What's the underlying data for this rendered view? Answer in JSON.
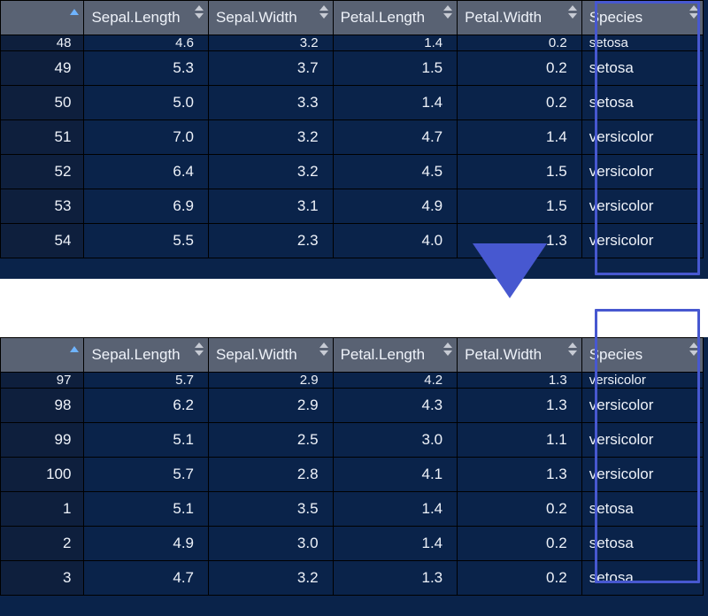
{
  "headers": {
    "index": "",
    "sepal_length": "Sepal.Length",
    "sepal_width": "Sepal.Width",
    "petal_length": "Petal.Length",
    "petal_width": "Petal.Width",
    "species": "Species"
  },
  "top": {
    "partial": {
      "idx": "48",
      "sl": "4.6",
      "sw": "3.2",
      "pl": "1.4",
      "pw": "0.2",
      "sp": "setosa"
    },
    "rows": [
      {
        "idx": "49",
        "sl": "5.3",
        "sw": "3.7",
        "pl": "1.5",
        "pw": "0.2",
        "sp": "setosa"
      },
      {
        "idx": "50",
        "sl": "5.0",
        "sw": "3.3",
        "pl": "1.4",
        "pw": "0.2",
        "sp": "setosa"
      },
      {
        "idx": "51",
        "sl": "7.0",
        "sw": "3.2",
        "pl": "4.7",
        "pw": "1.4",
        "sp": "versicolor"
      },
      {
        "idx": "52",
        "sl": "6.4",
        "sw": "3.2",
        "pl": "4.5",
        "pw": "1.5",
        "sp": "versicolor"
      },
      {
        "idx": "53",
        "sl": "6.9",
        "sw": "3.1",
        "pl": "4.9",
        "pw": "1.5",
        "sp": "versicolor"
      },
      {
        "idx": "54",
        "sl": "5.5",
        "sw": "2.3",
        "pl": "4.0",
        "pw": "1.3",
        "sp": "versicolor"
      }
    ]
  },
  "bottom": {
    "partial": {
      "idx": "97",
      "sl": "5.7",
      "sw": "2.9",
      "pl": "4.2",
      "pw": "1.3",
      "sp": "versicolor"
    },
    "rows": [
      {
        "idx": "98",
        "sl": "6.2",
        "sw": "2.9",
        "pl": "4.3",
        "pw": "1.3",
        "sp": "versicolor"
      },
      {
        "idx": "99",
        "sl": "5.1",
        "sw": "2.5",
        "pl": "3.0",
        "pw": "1.1",
        "sp": "versicolor"
      },
      {
        "idx": "100",
        "sl": "5.7",
        "sw": "2.8",
        "pl": "4.1",
        "pw": "1.3",
        "sp": "versicolor"
      },
      {
        "idx": "1",
        "sl": "5.1",
        "sw": "3.5",
        "pl": "1.4",
        "pw": "0.2",
        "sp": "setosa"
      },
      {
        "idx": "2",
        "sl": "4.9",
        "sw": "3.0",
        "pl": "1.4",
        "pw": "0.2",
        "sp": "setosa"
      },
      {
        "idx": "3",
        "sl": "4.7",
        "sw": "3.2",
        "pl": "1.3",
        "pw": "0.2",
        "sp": "setosa"
      }
    ]
  }
}
